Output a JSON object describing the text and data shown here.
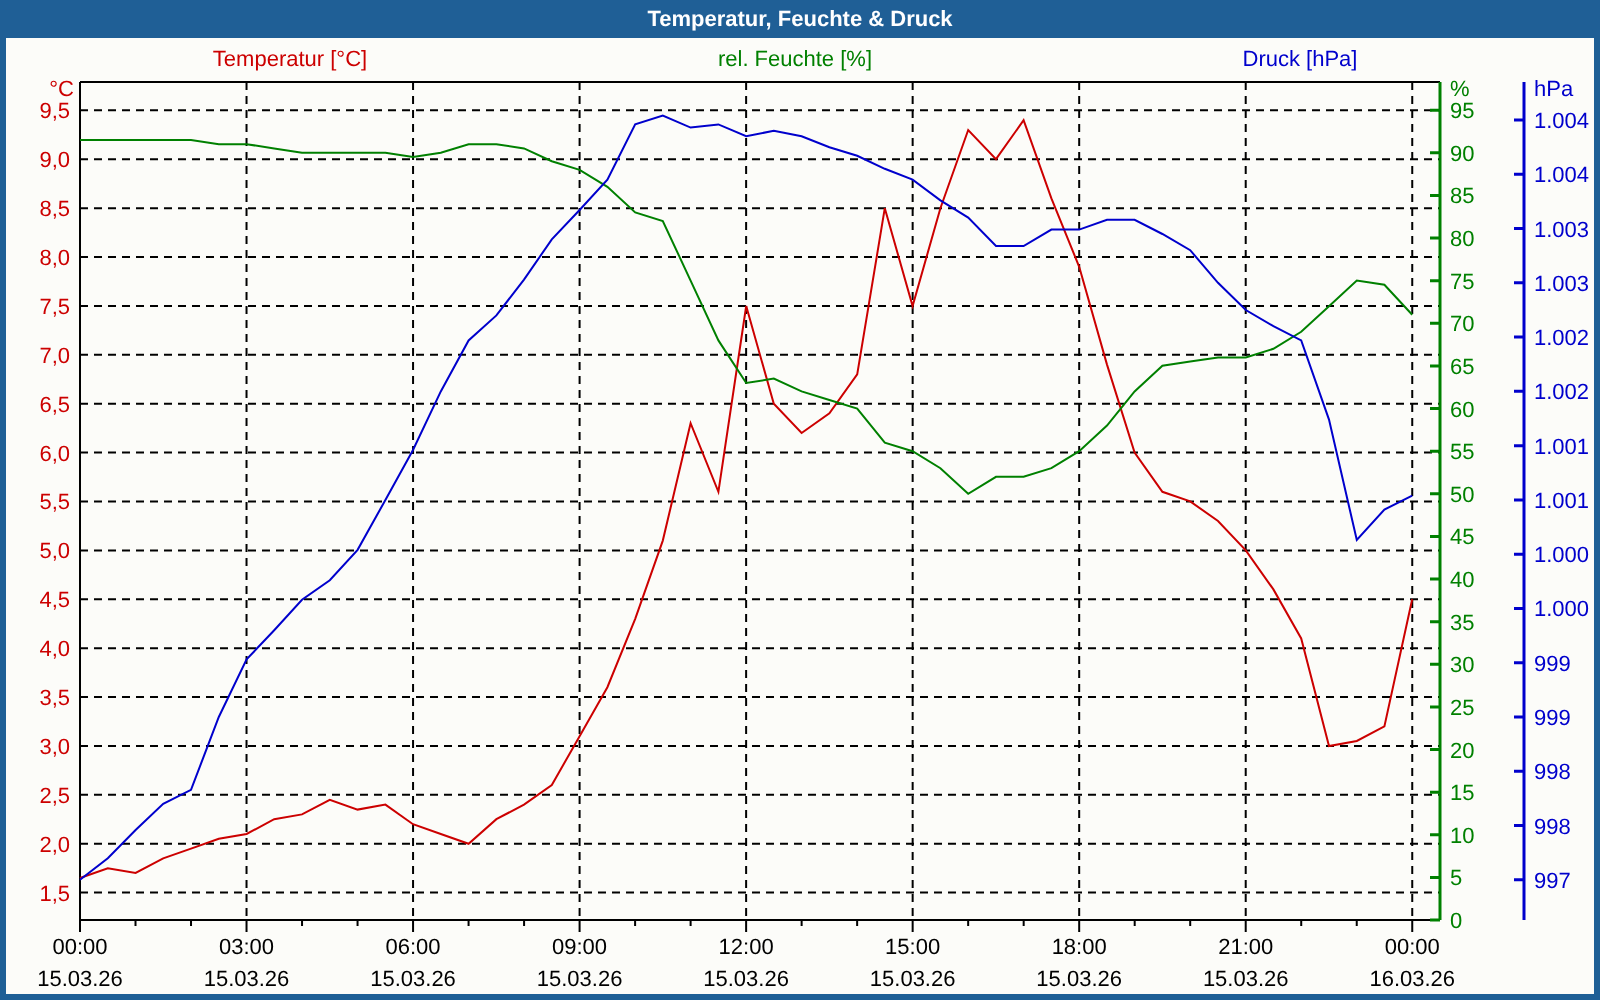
{
  "window": {
    "title": "Temperatur, Feuchte & Druck"
  },
  "chart": {
    "temperature": {
      "chart_data": {
        "type": "line",
        "grid": true,
        "title": "Temperatur [°C]",
        "ylabel": "°C",
        "xlim": [
          0,
          24.5
        ],
        "ylim": [
          1.22,
          9.79
        ],
        "x": [
          0,
          0.5,
          1,
          1.5,
          2,
          2.5,
          3,
          3.5,
          4,
          4.5,
          5,
          5.5,
          6,
          6.5,
          7,
          7.5,
          8,
          8.5,
          9,
          9.5,
          10,
          10.5,
          11,
          11.5,
          12,
          12.5,
          13,
          13.5,
          14,
          14.5,
          15,
          15.5,
          16,
          16.5,
          17,
          17.5,
          18,
          18.5,
          19,
          19.5,
          20,
          20.5,
          21,
          21.5,
          22,
          22.5,
          23,
          23.5,
          24
        ],
        "xticks": [
          {
            "value": 0,
            "label": "00:00"
          },
          {
            "value": 3,
            "label": "03:00"
          },
          {
            "value": 6,
            "label": "06:00"
          },
          {
            "value": 9,
            "label": "09:00"
          },
          {
            "value": 12,
            "label": "12:00"
          },
          {
            "value": 15,
            "label": "15:00"
          },
          {
            "value": 18,
            "label": "18:00"
          },
          {
            "value": 21,
            "label": "21:00"
          },
          {
            "value": 24,
            "label": "00:00"
          }
        ],
        "yticks": [
          {
            "value": 1.5,
            "label": "1,5"
          },
          {
            "value": 2,
            "label": "2,0"
          },
          {
            "value": 2.5,
            "label": "2,5"
          },
          {
            "value": 3,
            "label": "3,0"
          },
          {
            "value": 3.5,
            "label": "3,5"
          },
          {
            "value": 4,
            "label": "4,0"
          },
          {
            "value": 4.5,
            "label": "4,5"
          },
          {
            "value": 5,
            "label": "5,0"
          },
          {
            "value": 5.5,
            "label": "5,5"
          },
          {
            "value": 6,
            "label": "6,0"
          },
          {
            "value": 6.5,
            "label": "6,5"
          },
          {
            "value": 7,
            "label": "7,0"
          },
          {
            "value": 7.5,
            "label": "7,5"
          },
          {
            "value": 8,
            "label": "8,0"
          },
          {
            "value": 8.5,
            "label": "8,5"
          },
          {
            "value": 9,
            "label": "9,0"
          },
          {
            "value": 9.5,
            "label": "9,5"
          }
        ],
        "series": [
          {
            "color": "#cc0000",
            "values": [
              1.65,
              1.75,
              1.7,
              1.85,
              1.95,
              2.05,
              2.1,
              2.25,
              2.3,
              2.45,
              2.35,
              2.4,
              2.2,
              2.1,
              2.0,
              2.25,
              2.4,
              2.6,
              3.1,
              3.6,
              4.3,
              5.1,
              6.3,
              5.6,
              7.5,
              6.5,
              6.2,
              6.4,
              6.8,
              8.5,
              7.5,
              8.5,
              9.3,
              9.0,
              9.4,
              8.6,
              7.9,
              6.9,
              6.0,
              5.6,
              5.5,
              5.3,
              5.0,
              4.6,
              4.1,
              3.0,
              3.05,
              3.2,
              4.5
            ]
          }
        ]
      }
    },
    "humidity": {
      "chart_data": {
        "type": "line",
        "title": "rel. Feuchte [%]",
        "ylabel": "%",
        "xlim": [
          0,
          24.5
        ],
        "ylim": [
          0,
          98.3
        ],
        "x": [
          0,
          0.5,
          1,
          1.5,
          2,
          2.5,
          3,
          3.5,
          4,
          4.5,
          5,
          5.5,
          6,
          6.5,
          7,
          7.5,
          8,
          8.5,
          9,
          9.5,
          10,
          10.5,
          11,
          11.5,
          12,
          12.5,
          13,
          13.5,
          14,
          14.5,
          15,
          15.5,
          16,
          16.5,
          17,
          17.5,
          18,
          18.5,
          19,
          19.5,
          20,
          20.5,
          21,
          21.5,
          22,
          22.5,
          23,
          23.5,
          24
        ],
        "yticks": [
          0,
          5,
          10,
          15,
          20,
          25,
          30,
          35,
          40,
          45,
          50,
          55,
          60,
          65,
          70,
          75,
          80,
          85,
          90,
          95
        ],
        "series": [
          {
            "color": "#008000",
            "values": [
              91.5,
              91.5,
              91.5,
              91.5,
              91.5,
              91,
              91,
              90.5,
              90,
              90,
              90,
              90,
              89.5,
              90,
              91,
              91,
              90.5,
              89,
              88,
              86,
              83,
              82,
              75,
              68,
              63,
              63.5,
              62,
              61,
              60,
              56,
              55,
              53,
              50,
              52,
              52,
              53,
              55,
              58,
              62,
              65,
              65.5,
              66,
              66,
              67,
              69,
              72,
              75,
              74.5,
              71
            ]
          }
        ]
      }
    },
    "pressure": {
      "chart_data": {
        "type": "line",
        "title": "Druck [hPa]",
        "ylabel": "hPa",
        "xlim": [
          0,
          24.5
        ],
        "ylim": [
          996.63,
          1004.35
        ],
        "x": [
          0,
          0.5,
          1,
          1.5,
          2,
          2.5,
          3,
          3.5,
          4,
          4.5,
          5,
          5.5,
          6,
          6.5,
          7,
          7.5,
          8,
          8.5,
          9,
          9.5,
          10,
          10.5,
          11,
          11.5,
          12,
          12.5,
          13,
          13.5,
          14,
          14.5,
          15,
          15.5,
          16,
          16.5,
          17,
          17.5,
          18,
          18.5,
          19,
          19.5,
          20,
          20.5,
          21,
          21.5,
          22,
          22.5,
          23,
          23.5,
          24
        ],
        "yticks": [
          {
            "value": 997,
            "label": "997"
          },
          {
            "value": 997.5,
            "label": "998"
          },
          {
            "value": 998,
            "label": "998"
          },
          {
            "value": 998.5,
            "label": "999"
          },
          {
            "value": 999,
            "label": "999"
          },
          {
            "value": 999.5,
            "label": "1.000"
          },
          {
            "value": 1000,
            "label": "1.000"
          },
          {
            "value": 1000.5,
            "label": "1.001"
          },
          {
            "value": 1001,
            "label": "1.001"
          },
          {
            "value": 1001.5,
            "label": "1.002"
          },
          {
            "value": 1002,
            "label": "1.002"
          },
          {
            "value": 1002.5,
            "label": "1.003"
          },
          {
            "value": 1003,
            "label": "1.003"
          },
          {
            "value": 1003.5,
            "label": "1.004"
          },
          {
            "value": 1004,
            "label": "1.004"
          }
        ],
        "series": [
          {
            "color": "#0000cc",
            "values": [
              997.0,
              997.2,
              997.46,
              997.7,
              997.83,
              998.5,
              999.03,
              999.3,
              999.58,
              999.76,
              1000.04,
              1000.5,
              1000.96,
              1001.5,
              1001.97,
              1002.2,
              1002.53,
              1002.9,
              1003.17,
              1003.45,
              1003.96,
              1004.04,
              1003.93,
              1003.96,
              1003.85,
              1003.9,
              1003.85,
              1003.75,
              1003.67,
              1003.55,
              1003.45,
              1003.26,
              1003.1,
              1002.84,
              1002.84,
              1002.99,
              1002.99,
              1003.08,
              1003.08,
              1002.95,
              1002.8,
              1002.5,
              1002.25,
              1002.1,
              1001.97,
              1001.24,
              1000.13,
              1000.41,
              1000.54
            ]
          }
        ]
      }
    },
    "dates": [
      "15.03.26",
      "15.03.26",
      "15.03.26",
      "15.03.26",
      "15.03.26",
      "15.03.26",
      "15.03.26",
      "15.03.26",
      "16.03.26"
    ]
  }
}
